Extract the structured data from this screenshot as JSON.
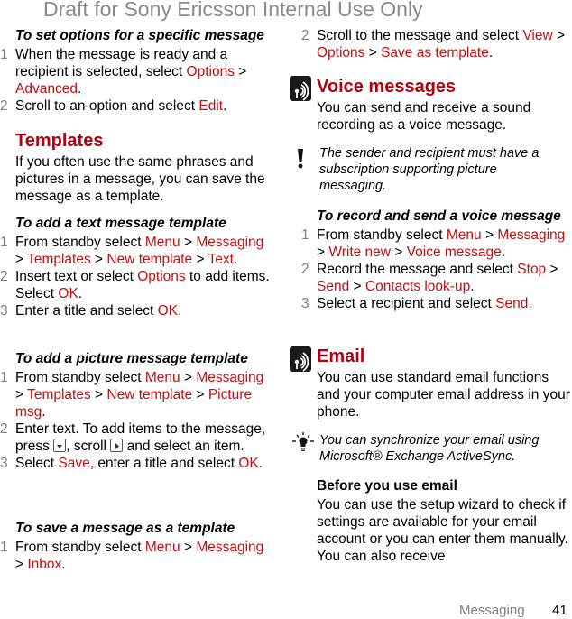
{
  "watermark": "Draft for Sony Ericsson Internal Use Only",
  "colors": {
    "accent": "#c40e0e",
    "heading": "#b3000f",
    "step_number": "#808080"
  },
  "left": {
    "set_options": {
      "title": "To set options for a specific message",
      "steps": [
        {
          "num": "1",
          "parts": [
            "When the message is ready and a recipient is selected, select ",
            "Options",
            " > ",
            "Advanced",
            "."
          ]
        },
        {
          "num": "2",
          "parts": [
            "Scroll to an option and select ",
            "Edit",
            "."
          ]
        }
      ]
    },
    "templates": {
      "heading": "Templates",
      "intro": "If you often use the same phrases and pictures in a message, you can save the message as a template."
    },
    "text_template": {
      "title": "To add a text message template",
      "steps": [
        {
          "num": "1",
          "parts": [
            "From standby select ",
            "Menu",
            " > ",
            "Messaging",
            " > ",
            "Templates",
            " > ",
            "New template",
            " > ",
            "Text",
            "."
          ]
        },
        {
          "num": "2",
          "parts": [
            "Insert text or select ",
            "Options",
            " to add items. Select ",
            "OK",
            "."
          ]
        },
        {
          "num": "3",
          "parts": [
            "Enter a title and select ",
            "OK",
            "."
          ]
        }
      ]
    },
    "picture_template": {
      "title": "To add a picture message template",
      "steps": [
        {
          "num": "1",
          "parts": [
            "From standby select ",
            "Menu",
            " > ",
            "Messaging",
            " > ",
            "Templates",
            " > ",
            "New template",
            " > ",
            "Picture msg",
            "."
          ]
        },
        {
          "num": "2",
          "parts": [
            "Enter text. To add items to the message, press ",
            "[select-key-icon]",
            ", scroll ",
            "[navigation-key-icon]",
            " and select an item."
          ]
        },
        {
          "num": "3",
          "parts": [
            "Select ",
            "Save",
            ", enter a title and select ",
            "OK",
            "."
          ]
        }
      ]
    },
    "save_template": {
      "title": "To save a message as a template",
      "steps": [
        {
          "num": "1",
          "parts": [
            "From standby select ",
            "Menu",
            " > ",
            "Messaging",
            " > ",
            "Inbox",
            "."
          ]
        }
      ]
    }
  },
  "right": {
    "save_template_cont": {
      "steps": [
        {
          "num": "2",
          "parts": [
            "Scroll to the message and select ",
            "View",
            " > ",
            "Options",
            " > ",
            "Save as template",
            "."
          ]
        }
      ]
    },
    "voice": {
      "icon": "operator-service-icon",
      "heading": "Voice messages",
      "intro": "You can send and receive a sound recording as a voice message.",
      "note_icon": "warning-icon",
      "note": "The sender and recipient must have a subscription supporting picture messaging.",
      "title": "To record and send a voice message",
      "steps": [
        {
          "num": "1",
          "parts": [
            "From standby select ",
            "Menu",
            " > ",
            "Messaging",
            " > ",
            "Write new",
            " > ",
            "Voice message",
            "."
          ]
        },
        {
          "num": "2",
          "parts": [
            "Record the message and select ",
            "Stop",
            " > ",
            "Send",
            " > ",
            "Contacts look-up",
            "."
          ]
        },
        {
          "num": "3",
          "parts": [
            "Select a recipient and select ",
            "Send",
            "."
          ]
        }
      ]
    },
    "email": {
      "icon": "operator-service-icon",
      "heading": "Email",
      "intro": "You can use standard email functions and your computer email address in your phone.",
      "tip_icon": "lightbulb-icon",
      "tip": "You can synchronize your email using Microsoft® Exchange ActiveSync.",
      "subhead": "Before you use email",
      "body": "You can use the setup wizard to check if settings are available for your email account or you can enter them manually. You can also receive"
    }
  },
  "footer": {
    "section": "Messaging",
    "page": "41"
  }
}
